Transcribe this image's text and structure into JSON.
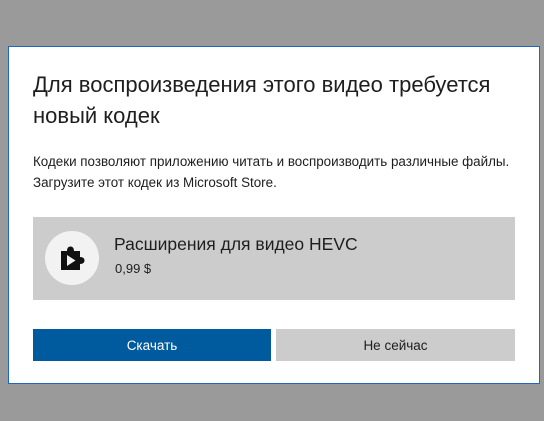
{
  "dialog": {
    "title": "Для воспроизведения этого видео требуется новый кодек",
    "description": "Кодеки позволяют приложению читать и воспроизводить различные файлы. Загрузите этот кодек из Microsoft Store.",
    "product": {
      "name": "Расширения для видео HEVC",
      "price": "0,99 $",
      "icon": "puzzle-play-icon"
    },
    "buttons": {
      "download_label": "Скачать",
      "not_now_label": "Не сейчас"
    }
  },
  "colors": {
    "overlay": "#9a9a9a",
    "dialog_border": "#1f66c2",
    "primary_button": "#005a9e",
    "secondary_button": "#cccccc",
    "card_background": "#cccccc"
  }
}
